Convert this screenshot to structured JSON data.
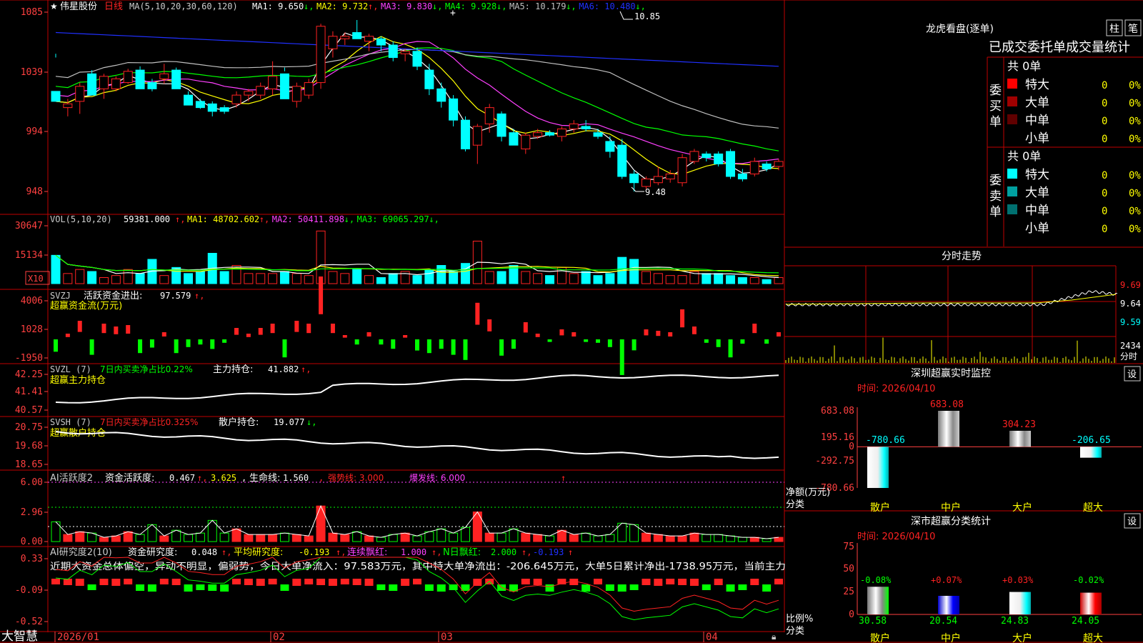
{
  "stock": {
    "name": "伟星股份",
    "period": "日线",
    "star": "★"
  },
  "colors": {
    "up": "#ff2222",
    "down": "#00ffff",
    "frame": "#c00000",
    "axis": "#ff4040",
    "ma1": "#ffffff",
    "ma2": "#ffff00",
    "ma3": "#ff40ff",
    "ma4": "#00ff00",
    "ma5": "#c0c0c0",
    "ma6": "#2030ff"
  },
  "price_panel": {
    "ma_param": "MA(5,10,20,30,60,120)",
    "ma_values": [
      {
        "label": "MA1:",
        "value": "9.650",
        "arrow": "↓"
      },
      {
        "label": "MA2:",
        "value": "9.732",
        "arrow": "↑"
      },
      {
        "label": "MA3:",
        "value": "9.830",
        "arrow": "↓"
      },
      {
        "label": "MA4:",
        "value": "9.928",
        "arrow": "↓"
      },
      {
        "label": "MA5:",
        "value": "10.179",
        "arrow": "↓"
      },
      {
        "label": "MA6:",
        "value": "10.480",
        "arrow": "↓"
      }
    ],
    "axis_labels": [
      "1085",
      "1039",
      "994",
      "948"
    ],
    "high_label": "10.85",
    "low_label": "9.48"
  },
  "vol_panel": {
    "title": "VOL(5,10,20)",
    "value": "59381.000",
    "ma": [
      {
        "label": "MA1:",
        "value": "48702.602",
        "arrow": "↑"
      },
      {
        "label": "MA2:",
        "value": "50411.898",
        "arrow": "↓"
      },
      {
        "label": "MA3:",
        "value": "69065.297",
        "arrow": "↓"
      }
    ],
    "axis_labels": [
      "30647",
      "15134"
    ],
    "unit": "X10"
  },
  "svzj_panel": {
    "title": "SVZJ",
    "line1_label": "活跃资金进出:",
    "line1_value": "97.579",
    "line2": "超赢资金流(万元)",
    "axis_labels": [
      "4006",
      "1028",
      "-1950"
    ]
  },
  "svzl_panel": {
    "title": "SVZL (7)",
    "label1": "7日内买卖净占比0.22%",
    "label2": "主力持仓:",
    "value2": "41.882",
    "line2": "超赢主力持仓",
    "axis_labels": [
      "42.25",
      "41.41",
      "40.57"
    ]
  },
  "svsh_panel": {
    "title": "SVSH (7)",
    "label1": "7日内买卖净占比0.325%",
    "label2": "散户持仓:",
    "value2": "19.077",
    "line2": "超赢散户持仓",
    "axis_labels": [
      "20.75",
      "19.68",
      "18.65"
    ]
  },
  "ai1_panel": {
    "title": "AI活跃度2",
    "label": "资金活跃度:",
    "v1": "0.467",
    "v2": "3.625",
    "life_label": "生命线:",
    "life": "1.560",
    "strong": "强势线: 3.000",
    "burst": "爆发线: 6.000",
    "axis_labels": [
      "6.00",
      "2.96",
      "0.00"
    ]
  },
  "ai2_panel": {
    "title": "AI研究度2(10)",
    "label": "资金研究度:",
    "v1": "0.048",
    "avg_label": "平均研究度:",
    "avg": "-0.193",
    "red_label": "连续飘红:",
    "red": "1.000",
    "nred_label": "N日飘红:",
    "nred": "2.000",
    "last": "-0.193",
    "comment": "近期大资金总体偏空，异动不明显，偏弱势，今日大单净流入：97.583万元，其中特大单净流出：-206.645万元，大单5日累计净出-1738.95万元，当前主力",
    "axis_labels": [
      "0.33",
      "-0.09",
      "-0.52"
    ]
  },
  "footer": {
    "brand": "大智慧",
    "dates": [
      "2026/01",
      "02",
      "03",
      "04"
    ]
  },
  "right_panel": {
    "title": "龙虎看盘(逐单)",
    "btn_column": "柱",
    "btn_count": "笔",
    "stats_title": "已成交委托单成交量统计",
    "buy_side": {
      "label": "委买单",
      "total": "共 0单",
      "rows": [
        {
          "name": "特大",
          "count": "0",
          "pct": "0%",
          "color": "#ff0000"
        },
        {
          "name": "大单",
          "count": "0",
          "pct": "0%",
          "color": "#a00000"
        },
        {
          "name": "中单",
          "count": "0",
          "pct": "0%",
          "color": "#600000"
        },
        {
          "name": "小单",
          "count": "0",
          "pct": "0%",
          "color": "#000000"
        }
      ]
    },
    "sell_side": {
      "label": "委卖单",
      "total": "共 0单",
      "rows": [
        {
          "name": "特大",
          "count": "0",
          "pct": "0%",
          "color": "#00ffff"
        },
        {
          "name": "大单",
          "count": "0",
          "pct": "0%",
          "color": "#00a0a0"
        },
        {
          "name": "中单",
          "count": "0",
          "pct": "0%",
          "color": "#007070"
        },
        {
          "name": "小单",
          "count": "0",
          "pct": "0%",
          "color": "#000000"
        }
      ]
    },
    "intraday": {
      "title": "分时走势",
      "axis_labels": [
        "9.69",
        "9.64",
        "9.59"
      ],
      "vol_label": "2434",
      "vol_unit": "分时"
    },
    "monitor": {
      "title": "深圳超赢实时监控",
      "set_btn": "设",
      "time": "时间: 2026/04/10",
      "axis_labels": [
        "683.08",
        "195.16",
        "0",
        "-292.75",
        "-780.66"
      ],
      "y_title": "净额(万元)",
      "x_title": "分类",
      "categories": [
        "散户",
        "中户",
        "大户",
        "超大"
      ],
      "values": [
        -780.66,
        683.08,
        304.23,
        -206.65
      ],
      "value_labels": [
        "-780.66",
        "683.08",
        "304.23",
        "-206.65"
      ]
    },
    "classify": {
      "title": "深市超赢分类统计",
      "set_btn": "设",
      "time": "时间: 2026/04/10",
      "axis_labels": [
        "75",
        "50",
        "25",
        "0"
      ],
      "y_title": "比例%",
      "x_title": "分类",
      "categories": [
        "散户",
        "中户",
        "大户",
        "超大"
      ],
      "values": [
        30.58,
        20.54,
        24.83,
        24.05
      ],
      "value_labels": [
        "30.58",
        "20.54",
        "24.83",
        "24.05"
      ],
      "changes": [
        "-0.08%",
        "+0.07%",
        "+0.03%",
        "-0.02%"
      ]
    }
  },
  "chart_data": {
    "type": "candlestick",
    "title": "伟星股份 日线",
    "x": [
      "2026/01",
      "02",
      "03",
      "04"
    ],
    "ylim": [
      9.48,
      10.85
    ],
    "candles": [
      [
        10.28,
        10.2,
        10.55,
        10.58
      ],
      [
        10.15,
        10.18,
        10.08,
        10.22
      ],
      [
        10.2,
        10.32,
        10.1,
        10.35
      ],
      [
        10.42,
        10.25,
        10.38,
        10.45
      ],
      [
        10.3,
        10.4,
        10.22,
        10.42
      ],
      [
        10.3,
        10.38,
        10.28,
        10.4
      ],
      [
        10.35,
        10.44,
        10.34,
        10.46
      ],
      [
        10.45,
        10.3,
        10.42,
        10.48
      ],
      [
        10.35,
        10.3,
        10.28,
        10.38
      ],
      [
        10.38,
        10.42,
        10.34,
        10.5
      ],
      [
        10.45,
        10.3,
        10.42,
        10.47
      ],
      [
        10.25,
        10.17,
        10.18,
        10.28
      ],
      [
        10.2,
        10.15,
        10.14,
        10.22
      ],
      [
        10.18,
        10.12,
        10.08,
        10.2
      ],
      [
        10.15,
        10.12,
        10.1,
        10.17
      ],
      [
        10.18,
        10.25,
        10.15,
        10.28
      ],
      [
        10.25,
        10.28,
        10.2,
        10.3
      ],
      [
        10.25,
        10.32,
        10.22,
        10.35
      ],
      [
        10.3,
        10.4,
        10.25,
        10.52
      ],
      [
        10.42,
        10.22,
        10.44,
        10.47
      ],
      [
        10.2,
        10.32,
        10.15,
        10.35
      ],
      [
        10.25,
        10.35,
        10.22,
        10.38
      ],
      [
        10.35,
        10.8,
        10.3,
        10.82
      ],
      [
        10.62,
        10.72,
        10.55,
        10.76
      ],
      [
        10.7,
        10.72,
        10.65,
        10.75
      ],
      [
        10.75,
        10.7,
        10.72,
        10.85
      ],
      [
        10.68,
        10.72,
        10.6,
        10.74
      ],
      [
        10.7,
        10.65,
        10.6,
        10.72
      ],
      [
        10.65,
        10.55,
        10.52,
        10.68
      ],
      [
        10.58,
        10.6,
        10.52,
        10.62
      ],
      [
        10.6,
        10.48,
        10.45,
        10.63
      ],
      [
        10.45,
        10.3,
        10.25,
        10.5
      ],
      [
        10.3,
        10.2,
        10.15,
        10.35
      ],
      [
        10.22,
        10.05,
        10.0,
        10.25
      ],
      [
        10.05,
        9.82,
        9.8,
        10.08
      ],
      [
        9.85,
        10.0,
        9.7,
        10.02
      ],
      [
        10.02,
        10.15,
        9.95,
        10.18
      ],
      [
        10.1,
        9.92,
        9.88,
        10.12
      ],
      [
        9.95,
        9.85,
        9.85,
        9.98
      ],
      [
        9.82,
        9.93,
        9.78,
        9.95
      ],
      [
        9.92,
        9.95,
        9.9,
        9.98
      ],
      [
        9.95,
        9.93,
        9.92,
        9.97
      ],
      [
        9.92,
        9.98,
        9.88,
        10.0
      ],
      [
        9.98,
        10.02,
        9.95,
        10.05
      ],
      [
        10.0,
        9.98,
        9.96,
        10.05
      ],
      [
        9.95,
        9.92,
        9.9,
        9.98
      ],
      [
        9.88,
        9.8,
        9.75,
        9.92
      ],
      [
        9.85,
        9.6,
        9.58,
        9.9
      ],
      [
        9.62,
        9.55,
        9.48,
        9.65
      ],
      [
        9.52,
        9.58,
        9.5,
        9.6
      ],
      [
        9.55,
        9.6,
        9.53,
        9.68
      ],
      [
        9.58,
        9.62,
        9.55,
        9.65
      ],
      [
        9.55,
        9.75,
        9.52,
        9.78
      ],
      [
        9.72,
        9.8,
        9.7,
        9.82
      ],
      [
        9.78,
        9.75,
        9.72,
        9.8
      ],
      [
        9.78,
        9.7,
        9.68,
        9.8
      ],
      [
        9.8,
        9.6,
        9.58,
        9.82
      ],
      [
        9.62,
        9.58,
        9.56,
        9.66
      ],
      [
        9.62,
        9.72,
        9.6,
        9.75
      ],
      [
        9.7,
        9.66,
        9.64,
        9.72
      ],
      [
        9.68,
        9.72,
        9.65,
        9.74
      ]
    ],
    "volume": [
      14,
      5,
      7,
      6,
      3,
      4,
      7,
      5,
      12,
      4,
      8,
      5,
      6,
      15,
      6,
      9,
      5,
      5,
      5,
      6,
      5,
      4,
      26,
      6,
      5,
      7,
      4,
      3,
      5,
      6,
      4,
      7,
      9,
      6,
      10,
      21,
      6,
      6,
      9,
      6,
      5,
      4,
      8,
      5,
      6,
      4,
      5,
      13,
      12,
      6,
      5,
      4,
      4,
      6,
      5,
      5,
      4,
      3,
      3,
      2,
      3
    ]
  }
}
